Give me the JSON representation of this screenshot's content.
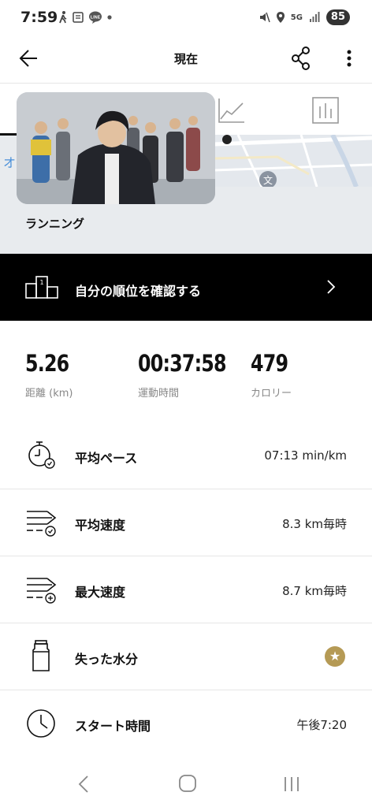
{
  "status_bar": {
    "time": "7:59",
    "left_icons": [
      "walk-icon",
      "news-icon",
      "line-icon",
      "dot"
    ],
    "line_label": "LINE",
    "right_icons": [
      "mute-icon",
      "location-icon",
      "5g-icon",
      "signal-icon"
    ],
    "network": "5G",
    "battery": "85"
  },
  "app_bar": {
    "title": "現在"
  },
  "tabs": {
    "items": [
      "map-tab",
      "chart-tab",
      "splits-tab"
    ],
    "selected": "map-tab"
  },
  "map": {
    "place_char": "オ",
    "activity_type": "ランニング"
  },
  "rank": {
    "label": "自分の順位を確認する",
    "podium_number": "1"
  },
  "stats": [
    {
      "value": "5.26",
      "label": "距離 (km)"
    },
    {
      "value": "00:37:58",
      "label": "運動時間"
    },
    {
      "value": "479",
      "label": "カロリー"
    }
  ],
  "metrics": [
    {
      "label": "平均ペース",
      "value": "07:13 min/km",
      "icon": "stopwatch-pace-icon"
    },
    {
      "label": "平均速度",
      "value": "8.3 km毎時",
      "icon": "speed-average-icon"
    },
    {
      "label": "最大速度",
      "value": "8.7 km毎時",
      "icon": "speed-max-icon"
    },
    {
      "label": "失った水分",
      "value": "",
      "icon": "water-bottle-icon",
      "badge": "star-icon"
    },
    {
      "label": "スタート時間",
      "value": "午後7:20",
      "icon": "clock-icon"
    }
  ],
  "colors": {
    "banner_bg": "#000000",
    "star_badge": "#b59a55",
    "map_blue": "#4a90d9"
  }
}
